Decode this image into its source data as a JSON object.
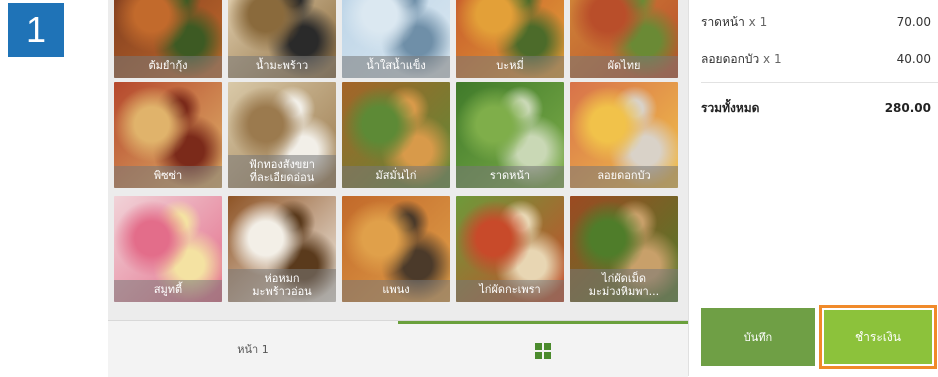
{
  "step_badge": "1",
  "menu": {
    "items": [
      {
        "label": "ต้มยำกุ้ง",
        "colors": [
          "#7a3a1e",
          "#c26a2c",
          "#3d5a23"
        ]
      },
      {
        "label": "น้ำมะพร้าว",
        "colors": [
          "#e8d7b8",
          "#8a6a3c",
          "#2a2a2a"
        ]
      },
      {
        "label": "น้ำใสน้ำแข็ง",
        "colors": [
          "#b9d2e6",
          "#dbe8f1",
          "#6f8fa8"
        ]
      },
      {
        "label": "บะหมี่",
        "colors": [
          "#c4542a",
          "#e3a038",
          "#4c6b2a"
        ]
      },
      {
        "label": "ผัดไทย",
        "colors": [
          "#d28a3a",
          "#b94e2a",
          "#6a8a35"
        ]
      },
      {
        "label": "พิซซ่า",
        "colors": [
          "#b5472c",
          "#e0b36b",
          "#7b2a1a"
        ]
      },
      {
        "label": "ฟักทองสังขยา\nที่ละเอียดอ่อน",
        "colors": [
          "#d9c9a8",
          "#9b7a4e",
          "#f2efe8"
        ]
      },
      {
        "label": "มัสมั่นไก่",
        "colors": [
          "#a56428",
          "#5d8a36",
          "#d89a4a"
        ]
      },
      {
        "label": "ราดหน้า",
        "colors": [
          "#3f7a2a",
          "#7fae4a",
          "#c9d8b5"
        ]
      },
      {
        "label": "ลอยดอกบัว",
        "colors": [
          "#d8724a",
          "#f1c24a",
          "#d9d2c8"
        ]
      },
      {
        "label": "สมูทตี้",
        "colors": [
          "#f1d3d8",
          "#e36d8a",
          "#f4e2a2"
        ]
      },
      {
        "label": "ห่อหมก\nมะพร้าวอ่อน",
        "colors": [
          "#8e5426",
          "#f3efe7",
          "#5a3a1c"
        ]
      },
      {
        "label": "แพนง",
        "colors": [
          "#c2692a",
          "#e0a04a",
          "#4b3a2a"
        ]
      },
      {
        "label": "ไก่ผัดกะเพรา",
        "colors": [
          "#6d9a3a",
          "#c84a2a",
          "#e8d6b3"
        ]
      },
      {
        "label": "ไก่ผัดเม็ด\nมะม่วงหิมพา...",
        "colors": [
          "#9c4a22",
          "#4f7d2a",
          "#c8a06a"
        ]
      }
    ]
  },
  "pager": {
    "page_label": "หน้า 1",
    "grid_icon": "grid-icon"
  },
  "order": {
    "lines": [
      {
        "name": "ราดหน้า",
        "qty": "x 1",
        "price": "70.00"
      },
      {
        "name": "ลอยดอกบัว",
        "qty": "x 1",
        "price": "40.00"
      }
    ],
    "total_label": "รวมทั้งหมด",
    "total_value": "280.00",
    "save_label": "บันทึก",
    "pay_label": "ชำระเงิน"
  },
  "colors": {
    "accent": "#8cc23b",
    "save": "#6f9f45",
    "highlight": "#f08a2a",
    "badge": "#1f73b7"
  }
}
